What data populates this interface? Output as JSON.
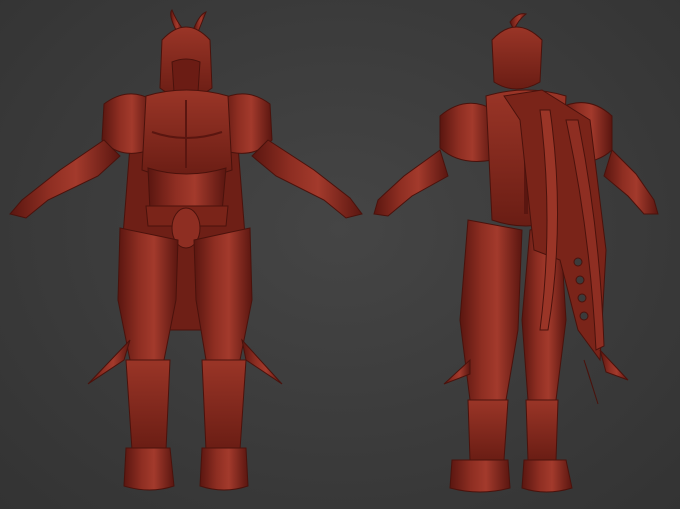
{
  "scene": {
    "background_color": "#3b3b3b",
    "material_color": "#8e2e22",
    "material_shadow": "#5a1610",
    "material_highlight": "#b44a3a",
    "views": [
      "front",
      "back"
    ],
    "subject": "armored-warrior-sculpt"
  }
}
